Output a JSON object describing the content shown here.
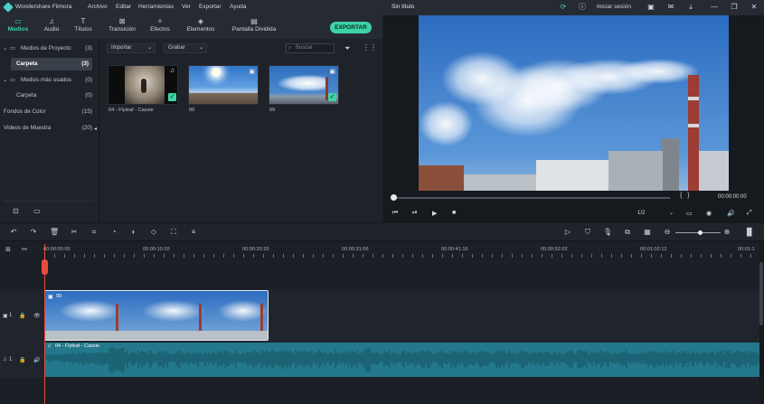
{
  "app": {
    "name": "Wondershare Filmora",
    "project_title": "Sin título",
    "menu": [
      "Archivo",
      "Editar",
      "Herramientas",
      "Ver",
      "Exportar",
      "Ayuda"
    ],
    "login_label": "Iniciar sesión"
  },
  "tabs": [
    {
      "label": "Medios",
      "icon": "folder-icon"
    },
    {
      "label": "Audio",
      "icon": "music-note-icon"
    },
    {
      "label": "Títulos",
      "icon": "text-icon"
    },
    {
      "label": "Transición",
      "icon": "transition-icon"
    },
    {
      "label": "Efectos",
      "icon": "effects-icon"
    },
    {
      "label": "Elementos",
      "icon": "elements-icon"
    },
    {
      "label": "Pantalla Dividida",
      "icon": "split-screen-icon"
    }
  ],
  "export_label": "EXPORTAR",
  "media_tree": [
    {
      "label": "Medios de Proyecto",
      "count": "(3)"
    },
    {
      "label": "Carpeta",
      "count": "(3)"
    },
    {
      "label": "Medios más usados",
      "count": "(0)"
    },
    {
      "label": "Carpeta",
      "count": "(0)"
    },
    {
      "label": "Fondos de Color",
      "count": "(15)"
    },
    {
      "label": "Videos de Muestra",
      "count": "(20)"
    }
  ],
  "media_toolbar": {
    "import_label": "Importar",
    "record_label": "Grabar",
    "search_placeholder": "Buscar"
  },
  "media_items": [
    {
      "label": "04 - Flyleaf - Cassie"
    },
    {
      "label": "06"
    },
    {
      "label": "09"
    }
  ],
  "preview": {
    "timecode": "00:00:00:00",
    "quality": "1/2"
  },
  "timeline": {
    "ruler_timecodes": [
      "00:00:00:00",
      "00:00:10:10",
      "00:00:20:20",
      "00:00:31:06",
      "00:00:41:16",
      "00:00:52:02",
      "00:01:02:12",
      "00:01:1"
    ],
    "video_clip_label": "09",
    "audio_clip_label": "04 - Flyleaf - Cassie",
    "video_track_label": "1",
    "audio_track_label": "1"
  },
  "colors": {
    "accent": "#3dd3a6",
    "playhead": "#e84c3d",
    "audio_clip": "#23788c"
  }
}
